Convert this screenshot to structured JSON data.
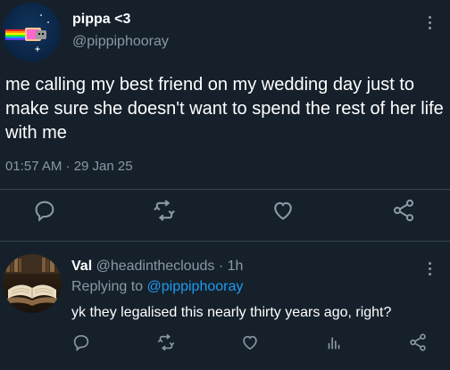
{
  "tweet": {
    "display_name": "pippa <3",
    "handle": "@pippiphooray",
    "text": "me calling my best friend on my wedding day just to make sure she doesn't want to spend the rest of her life with me",
    "timestamp": "01:57 AM · 29 Jan 25",
    "avatar_icon": "nyan-cat-icon",
    "actions": [
      "reply-icon",
      "retweet-icon",
      "like-icon",
      "share-icon"
    ]
  },
  "reply": {
    "display_name": "Val",
    "handle": "@headintheclouds",
    "separator": " · ",
    "time": "1h",
    "replying_to_label": "Replying to ",
    "replying_to_handle": "@pippiphooray",
    "text": "yk they legalised this nearly thirty years ago, right?",
    "avatar_icon": "open-book-icon",
    "actions": [
      "reply-icon",
      "retweet-icon",
      "like-icon",
      "analytics-icon",
      "share-icon"
    ]
  },
  "colors": {
    "background": "#15202b",
    "text": "#ffffff",
    "secondary_text": "#8b98a5",
    "link": "#1d9bf0",
    "divider": "#38444d"
  }
}
